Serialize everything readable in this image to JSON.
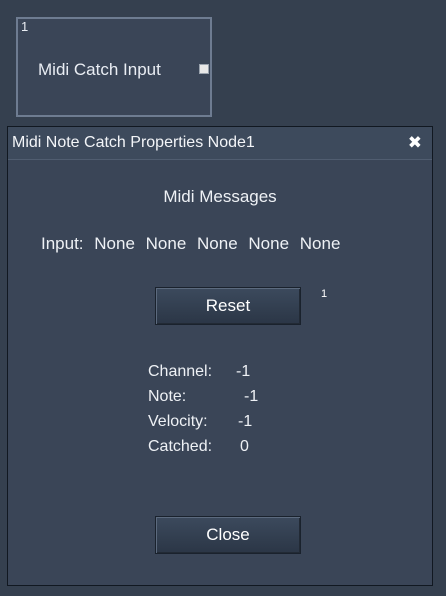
{
  "node": {
    "id": "1",
    "label": "Midi Catch Input"
  },
  "dialog": {
    "title": "Midi Note Catch Properties Node1",
    "close_icon": "✖",
    "section_title": "Midi Messages",
    "input_label": "Input:",
    "inputs": [
      "None",
      "None",
      "None",
      "None",
      "None"
    ],
    "reset_label": "Reset",
    "reset_badge": "1",
    "stats": {
      "channel": {
        "label": "Channel:",
        "value": "-1"
      },
      "note": {
        "label": "Note:",
        "value": "-1"
      },
      "velocity": {
        "label": "Velocity:",
        "value": "-1"
      },
      "catched": {
        "label": "Catched:",
        "value": "0"
      }
    },
    "close_label": "Close"
  }
}
